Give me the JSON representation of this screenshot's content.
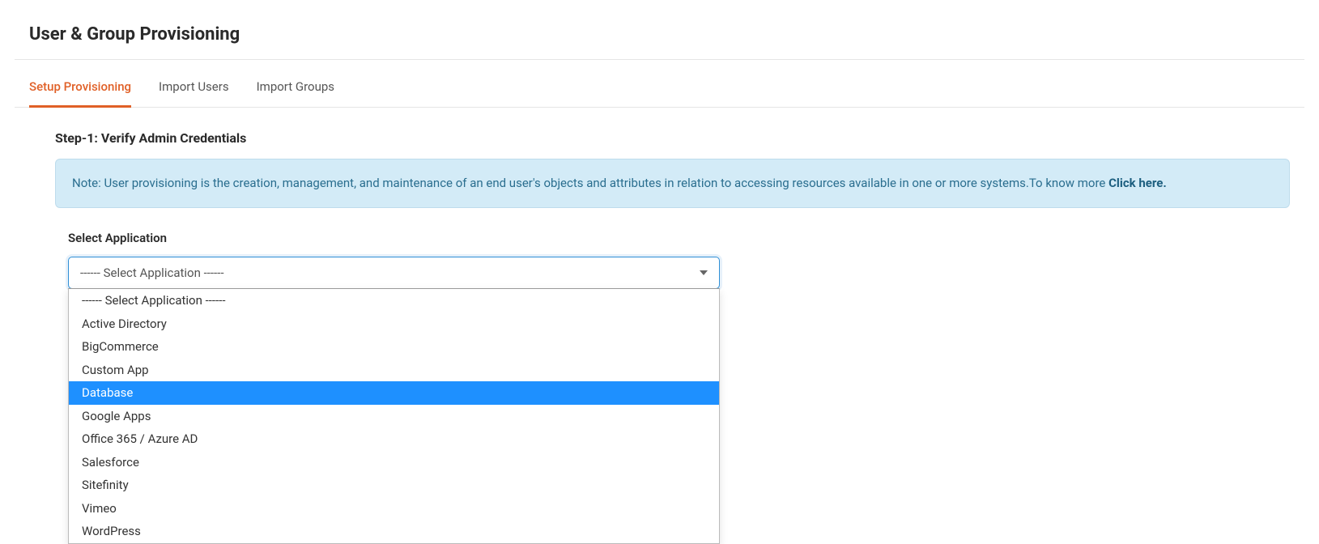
{
  "header": {
    "title": "User & Group Provisioning"
  },
  "tabs": [
    {
      "label": "Setup Provisioning",
      "active": true
    },
    {
      "label": "Import Users",
      "active": false
    },
    {
      "label": "Import Groups",
      "active": false
    }
  ],
  "step": {
    "title": "Step-1: Verify Admin Credentials"
  },
  "note": {
    "prefix": "Note: User provisioning is the creation, management, and maintenance of an end user's objects and attributes in relation to accessing resources available in one or more systems.To know more ",
    "link": "Click here."
  },
  "field": {
    "label": "Select Application",
    "selected": "------ Select Application ------",
    "options": [
      "------ Select Application ------",
      "Active Directory",
      "BigCommerce",
      "Custom App",
      "Database",
      "Google Apps",
      "Office 365 / Azure AD",
      "Salesforce",
      "Sitefinity",
      "Vimeo",
      "WordPress"
    ],
    "highlighted": "Database"
  }
}
